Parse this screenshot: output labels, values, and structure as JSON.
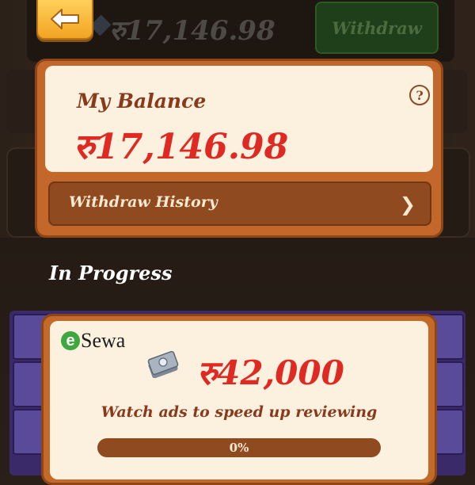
{
  "header": {
    "balance": "रु17,146.98",
    "withdraw_label": "Withdraw"
  },
  "balance_card": {
    "title": "My Balance",
    "amount": "रु17,146.98",
    "help_symbol": "?",
    "history_label": "Withdraw History"
  },
  "section": {
    "title": "In Progress"
  },
  "progress_card": {
    "provider_initial": "e",
    "provider_rest": "Sewa",
    "amount": "रु42,000",
    "note": "Watch ads to speed up reviewing",
    "progress_fraction": 0.0,
    "progress_label": "0%"
  },
  "colors": {
    "accent_red": "#df2a24",
    "card_cream": "#fbf1de",
    "wood_orange": "#c3672a",
    "esewa_green": "#3ea83e"
  },
  "icons": [
    "back-arrow-icon",
    "gem-icon",
    "help-icon",
    "chevron-right-icon",
    "money-stack-icon",
    "watermelon-tile-icon"
  ]
}
